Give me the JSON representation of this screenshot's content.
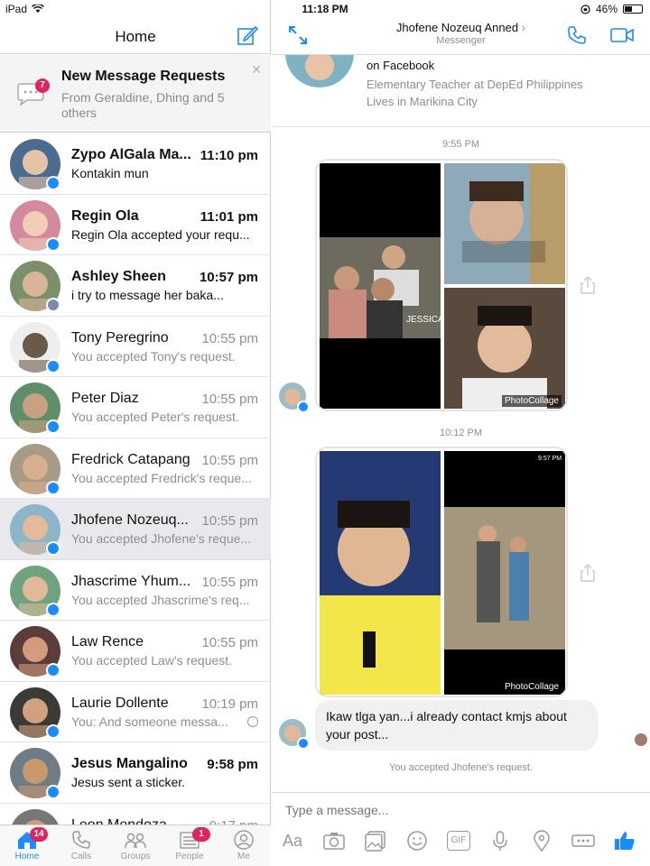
{
  "status_bar": {
    "device": "iPad",
    "time": "11:18 PM",
    "battery": "46%",
    "battery_level": 0.46
  },
  "left_pane": {
    "title": "Home",
    "message_requests": {
      "title": "New Message Requests",
      "subtitle": "From Geraldine, Dhing and 5 others",
      "badge": "7"
    },
    "conversations": [
      {
        "name": "Zypo AlGala Ma...",
        "time": "11:10 pm",
        "preview": "Kontakin mun",
        "unread": true,
        "badge": "messenger"
      },
      {
        "name": "Regin Ola",
        "time": "11:01 pm",
        "preview": "Regin Ola accepted your requ...",
        "unread": true,
        "badge": "messenger"
      },
      {
        "name": "Ashley Sheen",
        "time": "10:57 pm",
        "preview": "i try to message her baka...",
        "unread": true,
        "badge": "facebook"
      },
      {
        "name": "Tony Peregrino",
        "time": "10:55 pm",
        "preview": "You accepted Tony's request.",
        "unread": false,
        "badge": "messenger"
      },
      {
        "name": "Peter Diaz",
        "time": "10:55 pm",
        "preview": "You accepted Peter's request.",
        "unread": false,
        "badge": "messenger"
      },
      {
        "name": "Fredrick Catapang",
        "time": "10:55 pm",
        "preview": "You accepted Fredrick's reque...",
        "unread": false,
        "badge": "messenger"
      },
      {
        "name": "Jhofene Nozeuq...",
        "time": "10:55 pm",
        "preview": "You accepted Jhofene's reque...",
        "unread": false,
        "badge": "messenger",
        "selected": true
      },
      {
        "name": "Jhascrime Yhum...",
        "time": "10:55 pm",
        "preview": "You accepted Jhascrime's req...",
        "unread": false,
        "badge": "messenger"
      },
      {
        "name": "Law Rence",
        "time": "10:55 pm",
        "preview": "You accepted Law's request.",
        "unread": false,
        "badge": "messenger"
      },
      {
        "name": "Laurie Dollente",
        "time": "10:19 pm",
        "preview": "You: And someone messa...",
        "unread": false,
        "badge": "messenger",
        "read_receipt": true
      },
      {
        "name": "Jesus Mangalino",
        "time": "9:58 pm",
        "preview": "Jesus sent a sticker.",
        "unread": true,
        "badge": "messenger"
      },
      {
        "name": "Leon Mendoza",
        "time": "9:17 pm",
        "preview": "",
        "unread": false,
        "badge": "messenger"
      }
    ],
    "tabs": [
      {
        "label": "Home",
        "icon": "home-icon",
        "badge": "14",
        "active": true
      },
      {
        "label": "Calls",
        "icon": "phone-icon",
        "badge": "",
        "active": false
      },
      {
        "label": "Groups",
        "icon": "groups-icon",
        "badge": "",
        "active": false
      },
      {
        "label": "People",
        "icon": "people-list-icon",
        "badge": "1",
        "active": false
      },
      {
        "label": "Me",
        "icon": "profile-icon",
        "badge": "",
        "active": false
      }
    ]
  },
  "right_pane": {
    "contact_name": "Jhofene Nozeuq Anned",
    "contact_sub": "Messenger",
    "profile_lines": [
      "on Facebook",
      "Elementary Teacher at DepEd Philippines",
      "Lives in Marikina City"
    ],
    "timestamp_1": "9:55 PM",
    "timestamp_2": "10:12 PM",
    "collage_1": {
      "caption_text": "JESSICA SO-O",
      "watermark": "PhotoCollage"
    },
    "collage_2": {
      "watermark": "PhotoCollage",
      "status_time": "9:57 PM"
    },
    "message": "Ikaw tlga yan...i already contact kmjs about your post...",
    "system_note": "You accepted Jhofene's request.",
    "composer_placeholder": "Type a message...",
    "composer_aa": "Aa",
    "gif_label": "GIF",
    "accent": "#1a8cff"
  }
}
